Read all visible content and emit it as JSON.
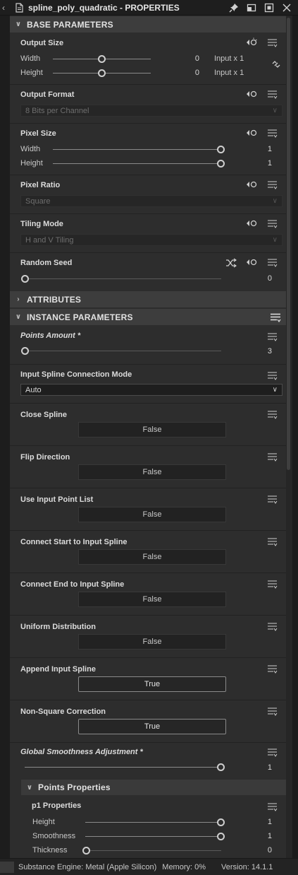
{
  "window": {
    "title": "spline_poly_quadratic - PROPERTIES"
  },
  "sections": {
    "base": "BASE PARAMETERS",
    "attributes": "ATTRIBUTES",
    "instance": "INSTANCE PARAMETERS",
    "points": "Points Properties"
  },
  "output_size": {
    "label": "Output Size",
    "width_label": "Width",
    "width_value": "0",
    "width_relative": "Input x 1",
    "width_level": 0.5,
    "height_label": "Height",
    "height_value": "0",
    "height_relative": "Input x 1",
    "height_level": 0.5
  },
  "output_format": {
    "label": "Output Format",
    "value": "8 Bits per Channel"
  },
  "pixel_size": {
    "label": "Pixel Size",
    "width_label": "Width",
    "width_value": "1",
    "width_level": 1.0,
    "height_label": "Height",
    "height_value": "1",
    "height_level": 1.0
  },
  "pixel_ratio": {
    "label": "Pixel Ratio",
    "value": "Square"
  },
  "tiling_mode": {
    "label": "Tiling Mode",
    "value": "H and V Tiling"
  },
  "random_seed": {
    "label": "Random Seed",
    "value": "0",
    "level": 0.0
  },
  "points_amount": {
    "label": "Points Amount *",
    "value": "3",
    "level": 0.0
  },
  "connection_mode": {
    "label": "Input Spline Connection Mode",
    "value": "Auto"
  },
  "bools": [
    {
      "label": "Close Spline",
      "value": "False"
    },
    {
      "label": "Flip Direction",
      "value": "False"
    },
    {
      "label": "Use Input Point List",
      "value": "False"
    },
    {
      "label": "Connect Start to Input Spline",
      "value": "False"
    },
    {
      "label": "Connect End to Input Spline",
      "value": "False"
    },
    {
      "label": "Uniform Distribution",
      "value": "False"
    },
    {
      "label": "Append Input Spline",
      "value": "True"
    },
    {
      "label": "Non-Square Correction",
      "value": "True"
    }
  ],
  "global_smoothness": {
    "label": "Global Smoothness Adjustment *",
    "value": "1",
    "level": 1.0
  },
  "p1": {
    "label": "p1 Properties",
    "height_label": "Height",
    "height_value": "1",
    "height_level": 1.0,
    "smoothness_label": "Smoothness",
    "smoothness_value": "1",
    "smoothness_level": 1.0,
    "thickness_label": "Thickness",
    "thickness_value": "0",
    "thickness_level": 0.0
  },
  "status": {
    "engine": "Substance Engine: Metal (Apple Silicon)",
    "memory": "Memory: 0%",
    "version": "Version: 14.1.1"
  },
  "icons": [
    "chevron-left-icon",
    "document-icon",
    "pin-icon",
    "float-window-icon",
    "maximize-icon",
    "close-icon",
    "inheritance-icon",
    "menu-icon",
    "link-icon",
    "shuffle-icon",
    "chevron-down-icon",
    "chevron-right-icon"
  ]
}
